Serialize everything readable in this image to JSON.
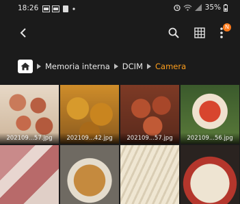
{
  "status_bar": {
    "time": "18:26",
    "battery": "35%",
    "icons": [
      "gallery-notification-icon",
      "gallery-notification-icon",
      "file-notification-icon",
      "dot-icon",
      "alarm-icon",
      "wifi-icon",
      "signal-icon",
      "battery-icon"
    ]
  },
  "app_bar": {
    "back_icon": "back-arrow-icon",
    "search_icon": "search-icon",
    "grid_icon": "grid-view-icon",
    "more_icon": "more-vert-icon",
    "badge": "N",
    "badge_color": "#ff7a1a"
  },
  "breadcrumb": {
    "home_icon": "home-icon",
    "items": [
      "Memoria interna",
      "DCIM",
      "Camera"
    ],
    "current_color": "#ff9f1c"
  },
  "files": [
    {
      "name": "202109...57.jpg"
    },
    {
      "name": "202109...42.jpg"
    },
    {
      "name": "202109...57.jpg"
    },
    {
      "name": "202109...56.jpg"
    },
    {
      "name": ""
    },
    {
      "name": ""
    },
    {
      "name": ""
    },
    {
      "name": ""
    }
  ]
}
